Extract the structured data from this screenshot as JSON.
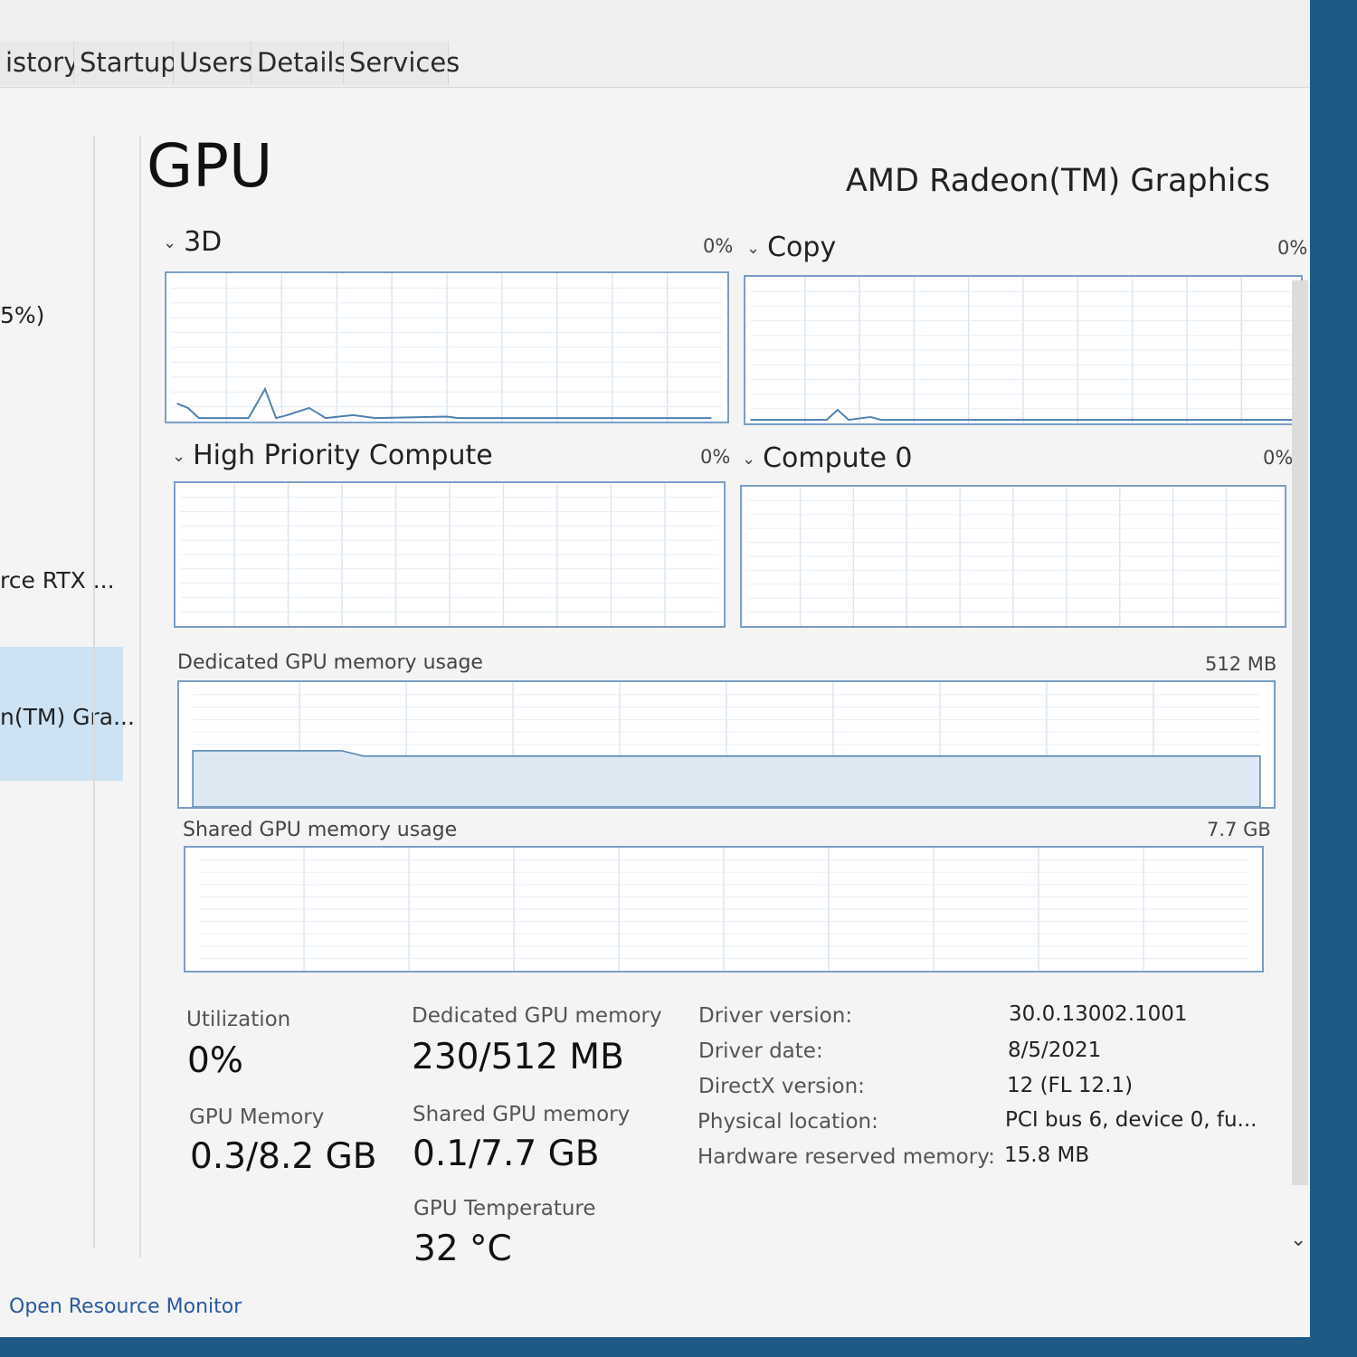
{
  "tabs": [
    "istory",
    "Startup",
    "Users",
    "Details",
    "Services"
  ],
  "sidebar": {
    "items": [
      {
        "label": "5%)"
      },
      {
        "label": "rce RTX ..."
      },
      {
        "label": "n(TM) Gra..."
      }
    ],
    "selected_index": 2
  },
  "header": {
    "title": "GPU",
    "gpu_name": "AMD Radeon(TM) Graphics"
  },
  "engines": [
    {
      "name": "3D",
      "percent": "0%"
    },
    {
      "name": "Copy",
      "percent": "0%"
    },
    {
      "name": "High Priority Compute",
      "percent": "0%"
    },
    {
      "name": "Compute 0",
      "percent": "0%"
    }
  ],
  "memory_graphs": {
    "dedicated": {
      "label": "Dedicated GPU memory usage",
      "max": "512 MB",
      "fill_fraction": 0.45
    },
    "shared": {
      "label": "Shared GPU memory usage",
      "max": "7.7 GB",
      "fill_fraction": 0.0
    }
  },
  "stats": {
    "utilization": {
      "label": "Utilization",
      "value": "0%"
    },
    "gpu_memory": {
      "label": "GPU Memory",
      "value": "0.3/8.2 GB"
    },
    "dedicated_memory": {
      "label": "Dedicated GPU memory",
      "value": "230/512 MB"
    },
    "shared_memory": {
      "label": "Shared GPU memory",
      "value": "0.1/7.7 GB"
    },
    "temperature": {
      "label": "GPU Temperature",
      "value": "32 °C"
    }
  },
  "info": [
    {
      "key": "Driver version:",
      "value": "30.0.13002.1001"
    },
    {
      "key": "Driver date:",
      "value": "8/5/2021"
    },
    {
      "key": "DirectX version:",
      "value": "12 (FL 12.1)"
    },
    {
      "key": "Physical location:",
      "value": "PCI bus 6, device 0, fu..."
    },
    {
      "key": "Hardware reserved memory:",
      "value": "15.8 MB"
    }
  ],
  "footer": {
    "link": "Open Resource Monitor"
  },
  "colors": {
    "graph_border": "#7a9fc7",
    "graph_line": "#4f7fae",
    "graph_fill": "#dde8f3",
    "selected": "#cde2f3"
  }
}
